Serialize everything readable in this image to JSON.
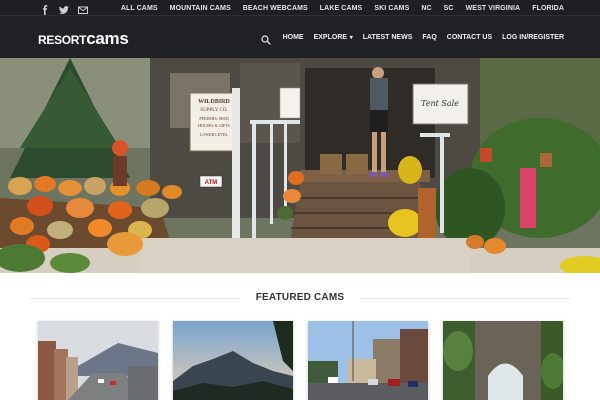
{
  "topbar": {
    "social_icons": [
      "facebook-icon",
      "twitter-icon",
      "email-icon"
    ],
    "links": [
      "ALL CAMS",
      "MOUNTAIN CAMS",
      "BEACH WEBCAMS",
      "LAKE CAMS",
      "SKI CAMS",
      "NC",
      "SC",
      "WEST VIRGINIA",
      "FLORIDA"
    ]
  },
  "header": {
    "logo_resort": "RESORT",
    "logo_cams": "cams",
    "nav": {
      "home": "HOME",
      "explore": "EXPLORE",
      "latest_news": "LATEST NEWS",
      "faq": "FAQ",
      "contact": "CONTACT US",
      "login": "LOG IN/REGISTER"
    }
  },
  "hero": {
    "signs": {
      "store_1": "WILDBIRD",
      "store_2": "SUPPLY CO.",
      "store_3": "FEEDERS, SEED",
      "store_4": "HOUSES & GIFTS",
      "store_5": "LOWER LEVEL",
      "atm": "ATM",
      "tent": "Tent Sale",
      "lower": "LOWER LEVEL"
    }
  },
  "featured": {
    "title": "FEATURED CAMS"
  },
  "colors": {
    "topbar_bg": "#1d1f22",
    "header_bg": "#1f2124",
    "nav_text": "#f0f0f0",
    "rule": "#e2e2e2"
  }
}
